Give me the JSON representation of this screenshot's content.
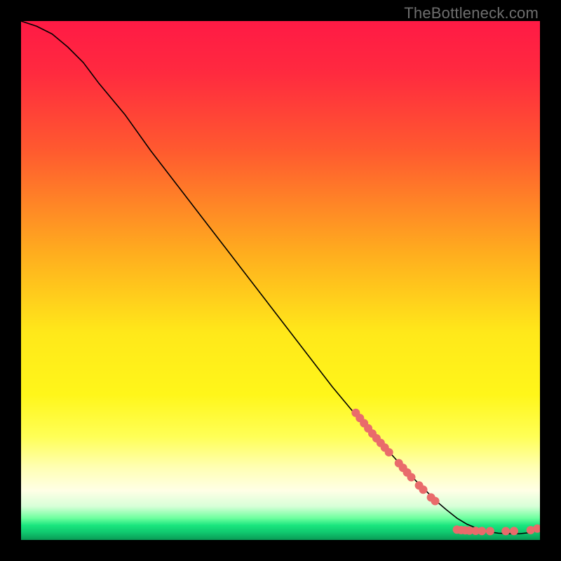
{
  "watermark": "TheBottleneck.com",
  "chart_data": {
    "type": "line",
    "title": "",
    "xlabel": "",
    "ylabel": "",
    "xlim": [
      0,
      100
    ],
    "ylim": [
      0,
      100
    ],
    "background_gradient": {
      "stops": [
        {
          "offset": 0.0,
          "color": "#ff1a45"
        },
        {
          "offset": 0.1,
          "color": "#ff2a3f"
        },
        {
          "offset": 0.25,
          "color": "#ff5a2f"
        },
        {
          "offset": 0.45,
          "color": "#ffae1e"
        },
        {
          "offset": 0.6,
          "color": "#ffe81a"
        },
        {
          "offset": 0.72,
          "color": "#fff61a"
        },
        {
          "offset": 0.8,
          "color": "#ffff55"
        },
        {
          "offset": 0.86,
          "color": "#ffffb3"
        },
        {
          "offset": 0.905,
          "color": "#ffffe6"
        },
        {
          "offset": 0.935,
          "color": "#d8ffd8"
        },
        {
          "offset": 0.958,
          "color": "#6dff9e"
        },
        {
          "offset": 0.972,
          "color": "#19e57e"
        },
        {
          "offset": 0.985,
          "color": "#10c96f"
        },
        {
          "offset": 1.0,
          "color": "#0a9a55"
        }
      ]
    },
    "series": [
      {
        "name": "curve",
        "color": "#000000",
        "stroke_width": 1.6,
        "x": [
          0,
          3,
          6,
          9,
          12,
          15,
          20,
          25,
          30,
          35,
          40,
          45,
          50,
          55,
          60,
          65,
          70,
          75,
          80,
          82,
          84,
          86,
          88,
          90,
          92,
          94,
          96,
          98,
          99.5
        ],
        "y": [
          100,
          99,
          97.5,
          95,
          92,
          88,
          82,
          75,
          68.5,
          62,
          55.5,
          49,
          42.5,
          36,
          29.5,
          23.5,
          18,
          12.5,
          7.5,
          5.8,
          4.2,
          3.0,
          2.2,
          1.6,
          1.3,
          1.2,
          1.2,
          1.4,
          1.8
        ]
      },
      {
        "name": "highlight-points",
        "color": "#e96b6b",
        "marker_radius": 6,
        "points": [
          {
            "x": 64.5,
            "y": 24.5
          },
          {
            "x": 65.3,
            "y": 23.5
          },
          {
            "x": 66.1,
            "y": 22.5
          },
          {
            "x": 66.9,
            "y": 21.5
          },
          {
            "x": 67.7,
            "y": 20.5
          },
          {
            "x": 68.5,
            "y": 19.6
          },
          {
            "x": 69.3,
            "y": 18.7
          },
          {
            "x": 70.1,
            "y": 17.8
          },
          {
            "x": 70.9,
            "y": 16.9
          },
          {
            "x": 72.8,
            "y": 14.8
          },
          {
            "x": 73.6,
            "y": 13.9
          },
          {
            "x": 74.4,
            "y": 13.0
          },
          {
            "x": 75.2,
            "y": 12.1
          },
          {
            "x": 76.7,
            "y": 10.5
          },
          {
            "x": 77.5,
            "y": 9.7
          },
          {
            "x": 79.0,
            "y": 8.2
          },
          {
            "x": 79.8,
            "y": 7.5
          },
          {
            "x": 84.0,
            "y": 2.0
          },
          {
            "x": 84.8,
            "y": 1.9
          },
          {
            "x": 85.6,
            "y": 1.85
          },
          {
            "x": 86.4,
            "y": 1.8
          },
          {
            "x": 87.6,
            "y": 1.75
          },
          {
            "x": 88.8,
            "y": 1.72
          },
          {
            "x": 90.4,
            "y": 1.7
          },
          {
            "x": 93.4,
            "y": 1.7
          },
          {
            "x": 95.0,
            "y": 1.72
          },
          {
            "x": 98.2,
            "y": 1.9
          },
          {
            "x": 99.5,
            "y": 2.2
          }
        ]
      }
    ]
  }
}
